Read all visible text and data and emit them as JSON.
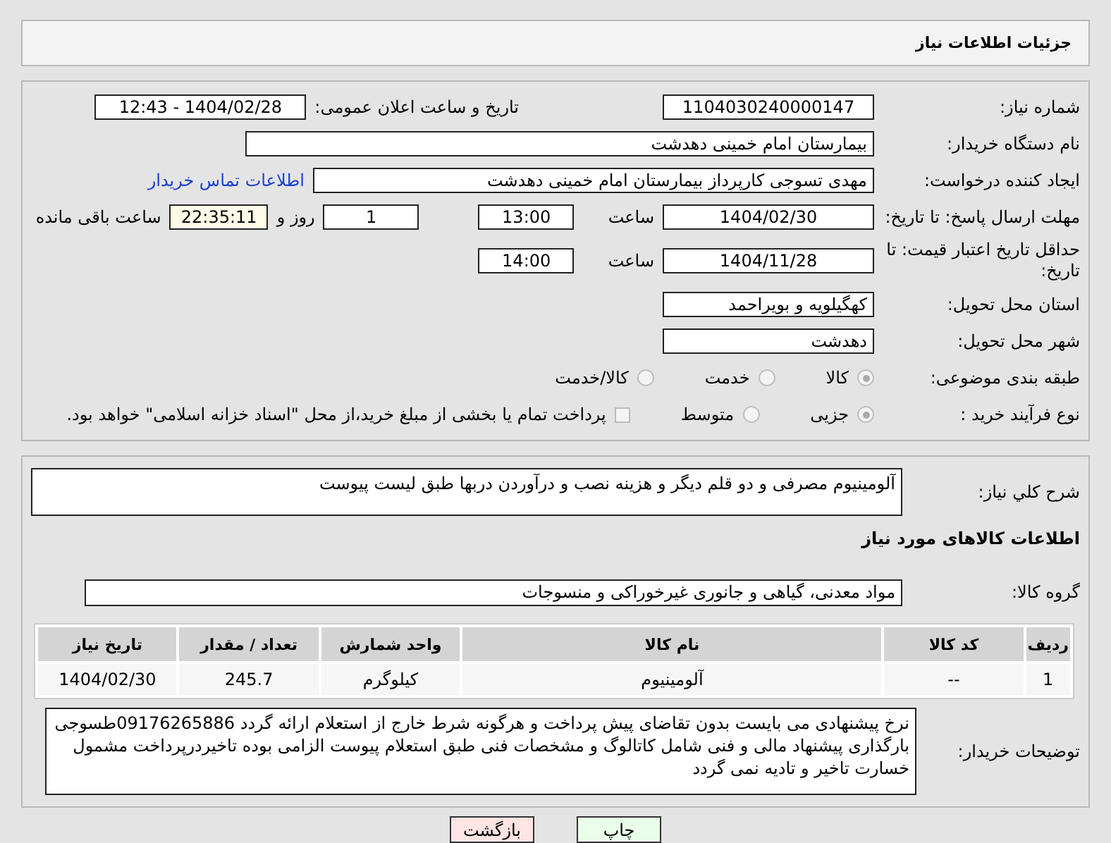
{
  "header": {
    "title": "جزئیات اطلاعات نیاز"
  },
  "need_number": {
    "label": "شماره نیاز:",
    "value": "1104030240000147"
  },
  "announce": {
    "label": "تاریخ و ساعت اعلان عمومی:",
    "value": "1404/02/28 - 12:43"
  },
  "buyer_org": {
    "label": "نام دستگاه خریدار:",
    "value": "بیمارستان امام خمینی دهدشت"
  },
  "requester": {
    "label": "ایجاد کننده درخواست:",
    "value": "مهدی تسوجی کارپرداز بیمارستان امام خمینی دهدشت",
    "link": "اطلاعات تماس خریدار"
  },
  "reply_deadline": {
    "label": "مهلت ارسال پاسخ: تا تاریخ:",
    "date": "1404/02/30",
    "time_label": "ساعت",
    "time": "13:00",
    "days": "1",
    "days_label": "روز و",
    "remaining": "22:35:11",
    "remaining_label": "ساعت باقی مانده"
  },
  "price_validity": {
    "label": "حداقل تاریخ اعتبار قیمت: تا تاریخ:",
    "date": "1404/11/28",
    "time_label": "ساعت",
    "time": "14:00"
  },
  "delivery_province": {
    "label": "استان محل تحویل:",
    "value": "کهگیلویه و بویراحمد"
  },
  "delivery_city": {
    "label": "شهر محل تحویل:",
    "value": "دهدشت"
  },
  "category": {
    "label": "طبقه بندی موضوعی:",
    "options": [
      {
        "label": "کالا",
        "selected": true
      },
      {
        "label": "خدمت",
        "selected": false
      },
      {
        "label": "کالا/خدمت",
        "selected": false
      }
    ]
  },
  "purchase_process": {
    "label": "نوع فرآیند خرید :",
    "options": [
      {
        "label": "جزیی",
        "selected": true
      },
      {
        "label": "متوسط",
        "selected": false
      }
    ],
    "treasury": {
      "checked": false,
      "text": "پرداخت تمام یا بخشی از مبلغ خرید،از محل \"اسناد خزانه اسلامی\" خواهد بود."
    }
  },
  "description": {
    "label": "شرح كلي نياز:",
    "value": "آلومینیوم مصرفی و دو قلم دیگر و هزینه نصب و درآوردن دربها طبق لیست پیوست"
  },
  "goods_title": "اطلاعات کالاهای مورد نیاز",
  "goods_group": {
    "label": "گروه کالا:",
    "value": "مواد معدنی، گیاهی و جانوری غیرخوراکی و منسوجات"
  },
  "table": {
    "columns": [
      "ردیف",
      "کد کالا",
      "نام کالا",
      "واحد شمارش",
      "تعداد / مقدار",
      "تاریخ نیاز"
    ],
    "rows": [
      [
        "1",
        "--",
        "آلومینیوم",
        "کیلوگرم",
        "245.7",
        "1404/02/30"
      ]
    ]
  },
  "buyer_notes": {
    "label": "توضیحات خریدار:",
    "value": "نرخ پیشنهادی می بایست بدون تقاضای پیش پرداخت و هرگونه شرط خارج از استعلام ارائه گردد 09176265886طسوجی بارگذاری پیشنهاد مالی و فنی شامل کاتالوگ و مشخصات فنی طبق استعلام پیوست الزامی بوده تاخیردرپرداخت مشمول خسارت تاخیر و تادیه نمی گردد"
  },
  "buttons": [
    {
      "label": "چاپ",
      "kind": "print"
    },
    {
      "label": "بازگشت",
      "kind": "back"
    }
  ]
}
